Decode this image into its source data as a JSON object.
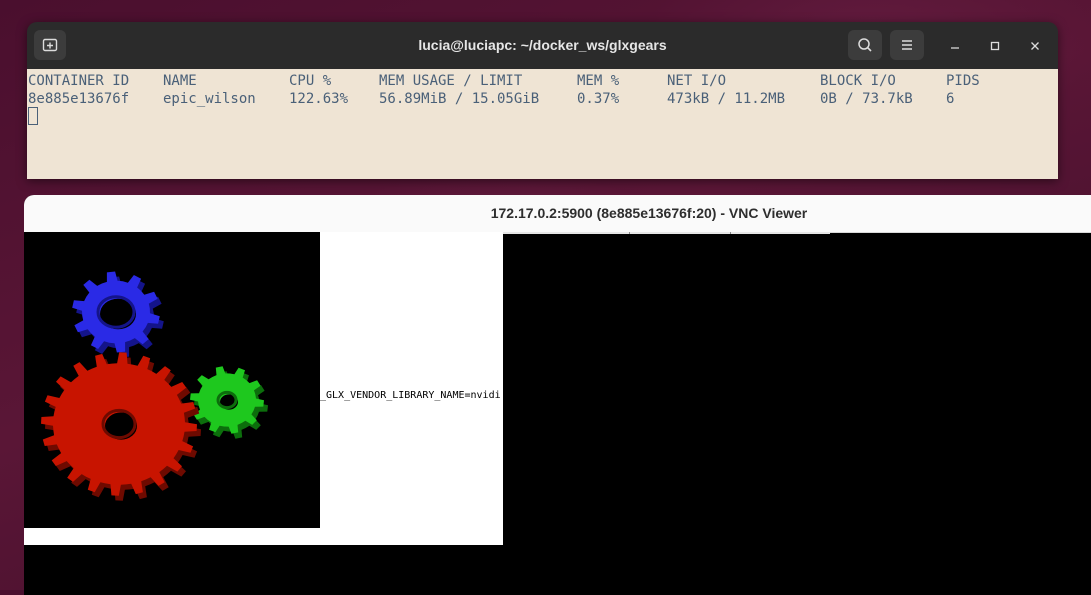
{
  "terminal": {
    "title": "lucia@luciapc: ~/docker_ws/glxgears",
    "header_icons": {
      "new_tab": "new-tab-icon",
      "search": "search-icon",
      "menu": "hamburger-menu-icon",
      "minimize": "minimize-icon",
      "maximize": "maximize-icon",
      "close": "close-icon"
    },
    "columns": [
      "CONTAINER ID",
      "NAME",
      "CPU %",
      "MEM USAGE / LIMIT",
      "MEM %",
      "NET I/O",
      "BLOCK I/O",
      "PIDS"
    ],
    "rows": [
      [
        "8e885e13676f",
        "epic_wilson",
        "122.63%",
        "56.89MiB / 15.05GiB",
        "0.37%",
        "473kB / 11.2MB",
        "0B / 73.7kB",
        "6"
      ]
    ]
  },
  "vnc": {
    "title": "172.17.0.2:5900 (8e885e13676f:20) - VNC Viewer",
    "env_text": "_GLX_VENDOR_LIBRARY_NAME=nvidi"
  },
  "colors": {
    "terminal_bg": "#efe4d4",
    "terminal_fg": "#4a6078",
    "header_bg": "#2b2b2b",
    "gear_red": "#c81400",
    "gear_green": "#1ec81e",
    "gear_blue": "#2a2ae6"
  }
}
